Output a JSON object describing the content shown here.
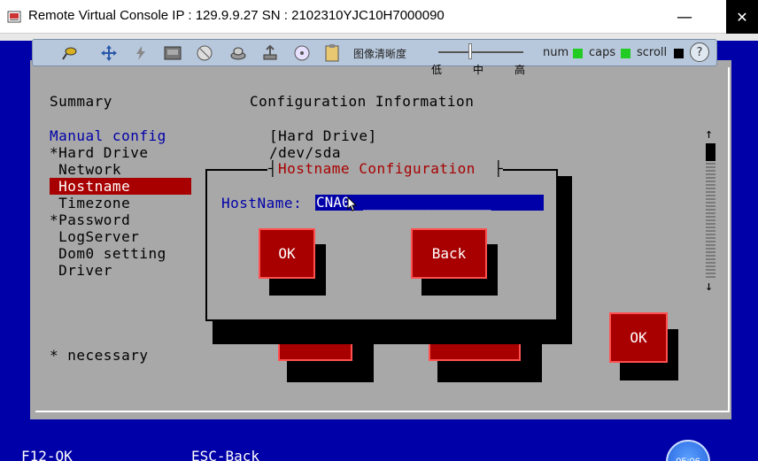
{
  "window": {
    "title": "Remote Virtual Console   IP : 129.9.9.27   SN : 2102310YJC10H7000090",
    "minimize_glyph": "—",
    "close_glyph": "✕"
  },
  "toolbar": {
    "icons": [
      "pin-icon",
      "move-icon",
      "power-icon",
      "keyboard-icon",
      "disc-icon",
      "drive-icon",
      "usb-icon",
      "cd-icon",
      "clip-icon"
    ],
    "quality_label": "图像清晰度",
    "quality_low": "低",
    "quality_mid": "中",
    "quality_high": "高",
    "num_label": "num",
    "caps_label": "caps",
    "scroll_label": "scroll",
    "num_color": "#22cc22",
    "caps_color": "#22cc22",
    "scroll_color": "#000000",
    "help_label": "?"
  },
  "console": {
    "summary": "Summary",
    "config_info": "Configuration Information",
    "menu_title": "Manual config",
    "menu": [
      "*Hard Drive",
      " Network",
      " Hostname",
      " Timezone",
      "*Password",
      " LogServer",
      " Dom0 setting",
      " Driver"
    ],
    "selected_index": 2,
    "necessary_note": "* necessary",
    "info_line1": "[Hard Drive]",
    "info_line2": "/dev/sda",
    "ok_main": "OK"
  },
  "dialog": {
    "title": "Hostname Configuration",
    "field_label": "HostName:",
    "field_value": "CNA0",
    "field_fill": "_______________",
    "ok_label": "OK",
    "back_label": "Back"
  },
  "footer": {
    "f12": "F12-OK",
    "esc": "ESC-Back",
    "clock": "05:06"
  }
}
